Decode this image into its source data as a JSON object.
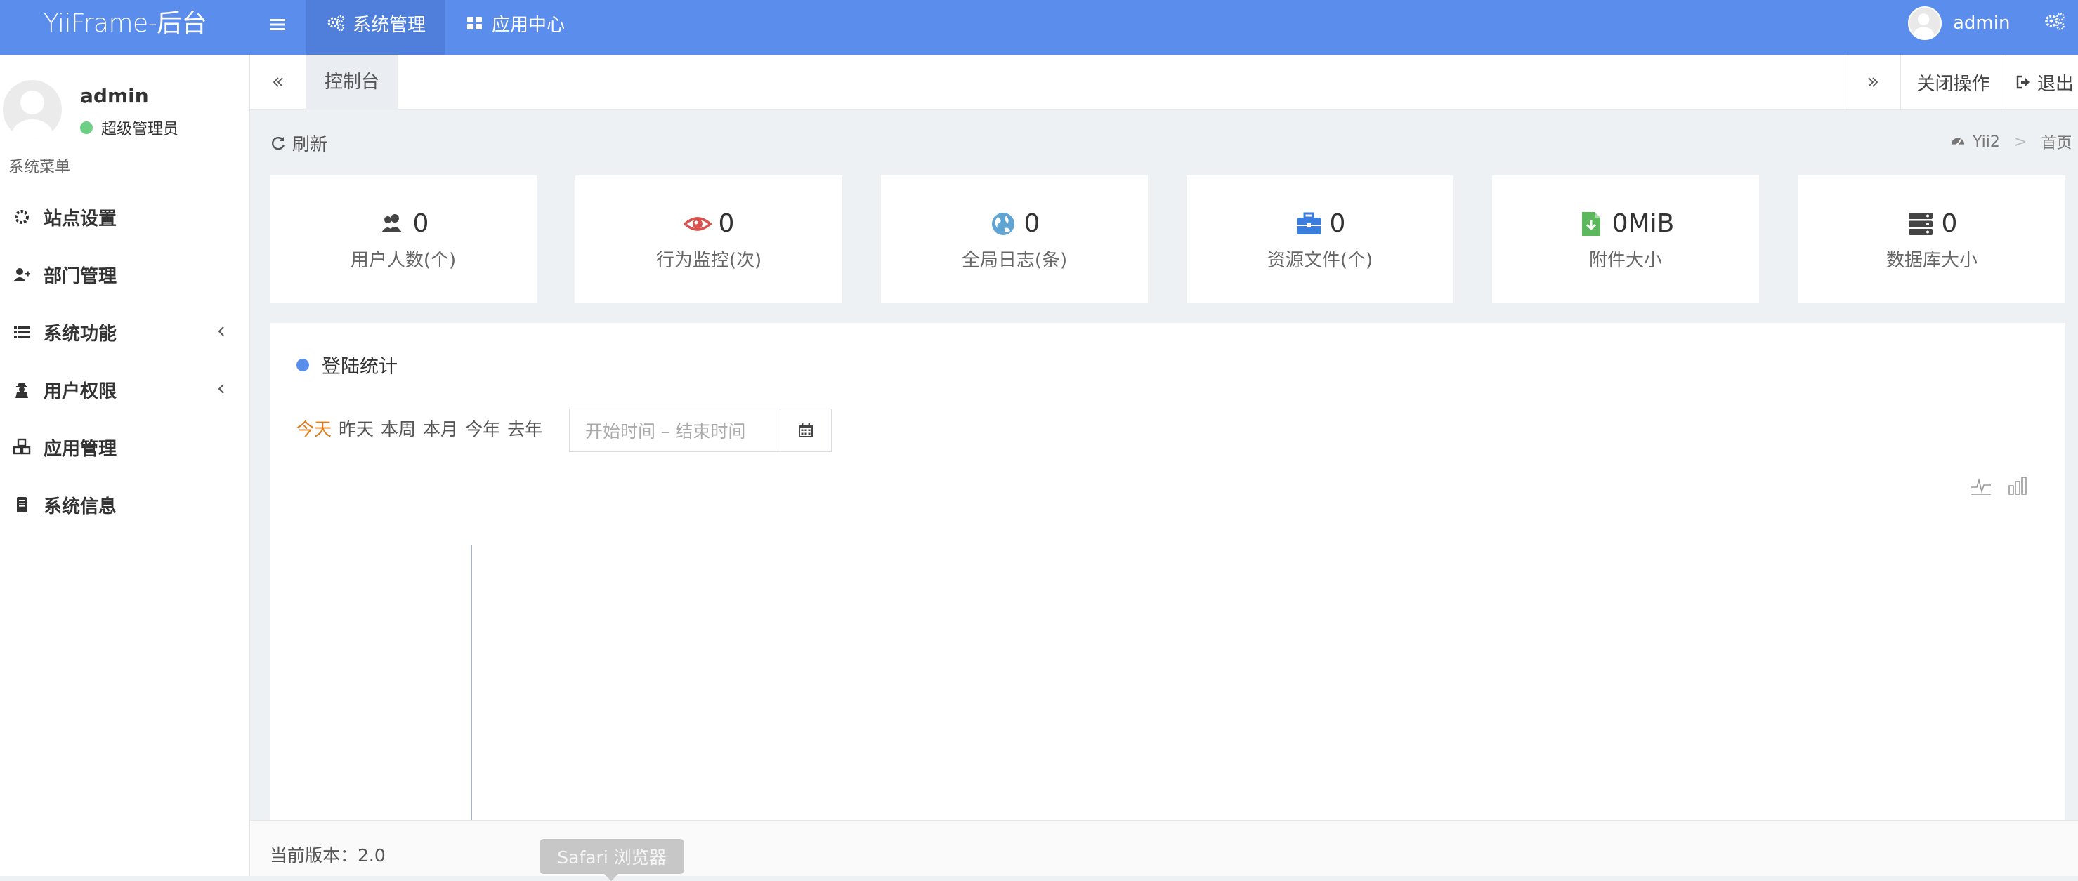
{
  "topbar": {
    "brand": "YiiFrame-后台",
    "nav": [
      {
        "label": "系统管理",
        "icon": "cogs-icon",
        "active": true
      },
      {
        "label": "应用中心",
        "icon": "grid-icon",
        "active": false
      }
    ],
    "user": "admin"
  },
  "sidebar": {
    "name": "admin",
    "role": "超级管理员",
    "menu_header": "系统菜单",
    "items": [
      {
        "label": "站点设置",
        "icon": "gear-icon"
      },
      {
        "label": "部门管理",
        "icon": "user-plus-icon"
      },
      {
        "label": "系统功能",
        "icon": "list-icon",
        "expandable": true
      },
      {
        "label": "用户权限",
        "icon": "user-secret-icon",
        "expandable": true
      },
      {
        "label": "应用管理",
        "icon": "cubes-icon"
      },
      {
        "label": "系统信息",
        "icon": "server-icon"
      }
    ]
  },
  "tabs": {
    "active": "控制台",
    "close_ops": "关闭操作",
    "logout": "退出"
  },
  "toolbar": {
    "refresh": "刷新",
    "breadcrumb": [
      "Yii2",
      "首页"
    ]
  },
  "stats": [
    {
      "value": "0",
      "label": "用户人数(个)",
      "icon": "users-icon",
      "color": "#444444"
    },
    {
      "value": "0",
      "label": "行为监控(次)",
      "icon": "eye-icon",
      "color": "#d9534f"
    },
    {
      "value": "0",
      "label": "全局日志(条)",
      "icon": "globe-icon",
      "color": "#5fa4d3"
    },
    {
      "value": "0",
      "label": "资源文件(个)",
      "icon": "briefcase-icon",
      "color": "#3b7ddd"
    },
    {
      "value": "0MiB",
      "label": "附件大小",
      "icon": "file-download-icon",
      "color": "#5cb85c"
    },
    {
      "value": "0",
      "label": "数据库大小",
      "icon": "database-icon",
      "color": "#444444"
    }
  ],
  "login_stats": {
    "title": "登陆统计",
    "ranges": [
      "今天",
      "昨天",
      "本周",
      "本月",
      "今年",
      "去年"
    ],
    "selected_range": "今天",
    "date_placeholder": "开始时间 – 结束时间"
  },
  "footer": {
    "version": "当前版本：2.0",
    "tooltip": "Safari 浏览器"
  },
  "colors": {
    "topbar": "#5b8eec",
    "accent_selected": "#e07a1b",
    "status_online": "#6ccf84"
  }
}
